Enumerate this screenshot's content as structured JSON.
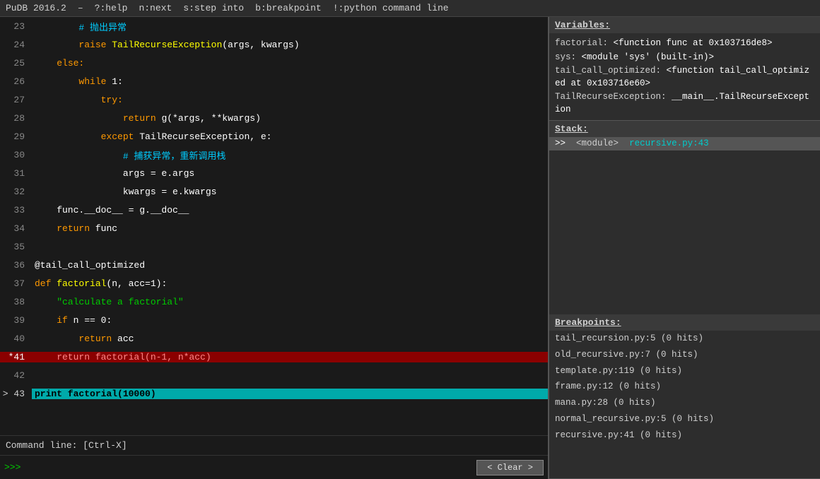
{
  "menubar": {
    "title": "PuDB 2016.2",
    "items": [
      {
        "key": "?",
        "label": "?:help"
      },
      {
        "key": "n",
        "label": "n:next"
      },
      {
        "key": "s",
        "label": "s:step into"
      },
      {
        "key": "b",
        "label": "b:breakpoint"
      },
      {
        "key": "!",
        "label": "!:python command line"
      }
    ]
  },
  "code": {
    "lines": [
      {
        "num": "23",
        "type": "normal",
        "html": "        <span class='kw-comment'># 抛出异常</span>"
      },
      {
        "num": "24",
        "type": "normal",
        "html": "        <span class='kw-raise'>raise</span> <span class='kw-funcname'>TailRecurseException</span><span class='kw-normal'>(args, kwargs)</span>"
      },
      {
        "num": "25",
        "type": "normal",
        "html": "    <span class='kw-else'>else:</span>"
      },
      {
        "num": "26",
        "type": "normal",
        "html": "        <span class='kw-while'>while</span> <span class='kw-normal'>1:</span>"
      },
      {
        "num": "27",
        "type": "normal",
        "html": "            <span class='kw-try'>try:</span>"
      },
      {
        "num": "28",
        "type": "normal",
        "html": "                <span class='kw-return'>return</span> <span class='kw-normal'>g(*args, **kwargs)</span>"
      },
      {
        "num": "29",
        "type": "normal",
        "html": "            <span class='kw-except'>except</span> <span class='kw-normal'>TailRecurseException, e:</span>"
      },
      {
        "num": "30",
        "type": "normal",
        "html": "                <span class='kw-comment'># 捕获异常，重新调用栈</span>"
      },
      {
        "num": "31",
        "type": "normal",
        "html": "                <span class='kw-normal'>args = e.args</span>"
      },
      {
        "num": "32",
        "type": "normal",
        "html": "                <span class='kw-normal'>kwargs = e.kwargs</span>"
      },
      {
        "num": "33",
        "type": "normal",
        "html": "    <span class='kw-normal'>func.__doc__ = g.__doc__</span>"
      },
      {
        "num": "34",
        "type": "normal",
        "html": "    <span class='kw-return'>return</span> <span class='kw-normal'>func</span>"
      },
      {
        "num": "35",
        "type": "normal",
        "html": ""
      },
      {
        "num": "36",
        "type": "normal",
        "html": "<span class='kw-at'>@tail_call_optimized</span>"
      },
      {
        "num": "37",
        "type": "normal",
        "html": "<span class='kw-def'>def</span> <span class='kw-funcname'>factorial</span><span class='kw-normal'>(n, acc=1):</span>"
      },
      {
        "num": "38",
        "type": "normal",
        "html": "    <span class='kw-string'>\"calculate a factorial\"</span>"
      },
      {
        "num": "39",
        "type": "normal",
        "html": "    <span class='kw-if'>if</span> <span class='kw-normal'>n == 0:</span>"
      },
      {
        "num": "40",
        "type": "normal",
        "html": "        <span class='kw-return'>return</span> <span class='kw-normal'>acc</span>"
      },
      {
        "num": "*41",
        "type": "breakpoint",
        "html": "    <span style='color:#ff6666'>return factorial(n-1, n*acc)</span>"
      },
      {
        "num": "42",
        "type": "normal",
        "html": ""
      },
      {
        "num": "43",
        "type": "current",
        "html": "<span style='color:#000000'>print factorial(10000)</span>"
      }
    ]
  },
  "command_line": {
    "label": "Command line: [Ctrl-X]"
  },
  "console": {
    "prompt": ">>>",
    "input_value": ""
  },
  "clear_button": {
    "label": "< Clear >"
  },
  "variables": {
    "title": "Variables:",
    "items": [
      {
        "name": "factorial:",
        "value": "<function func at 0x103716de8>"
      },
      {
        "name": "sys:",
        "value": "<module 'sys' (built-in)>"
      },
      {
        "name": "tail_call_optimized:",
        "value": "<function tail_call_optimized at 0x103716e60>"
      },
      {
        "name": "TailRecurseException:",
        "value": "__main__.TailRecurseException"
      }
    ]
  },
  "stack": {
    "title": "Stack:",
    "items": [
      {
        "arrow": ">>",
        "module": "<module>",
        "file": "recursive.py:43",
        "current": true
      }
    ]
  },
  "breakpoints": {
    "title": "Breakpoints:",
    "items": [
      "tail_recursion.py:5 (0 hits)",
      "old_recursive.py:7 (0 hits)",
      "template.py:119 (0 hits)",
      "frame.py:12 (0 hits)",
      "mana.py:28 (0 hits)",
      "normal_recursive.py:5 (0 hits)",
      "recursive.py:41 (0 hits)"
    ]
  }
}
